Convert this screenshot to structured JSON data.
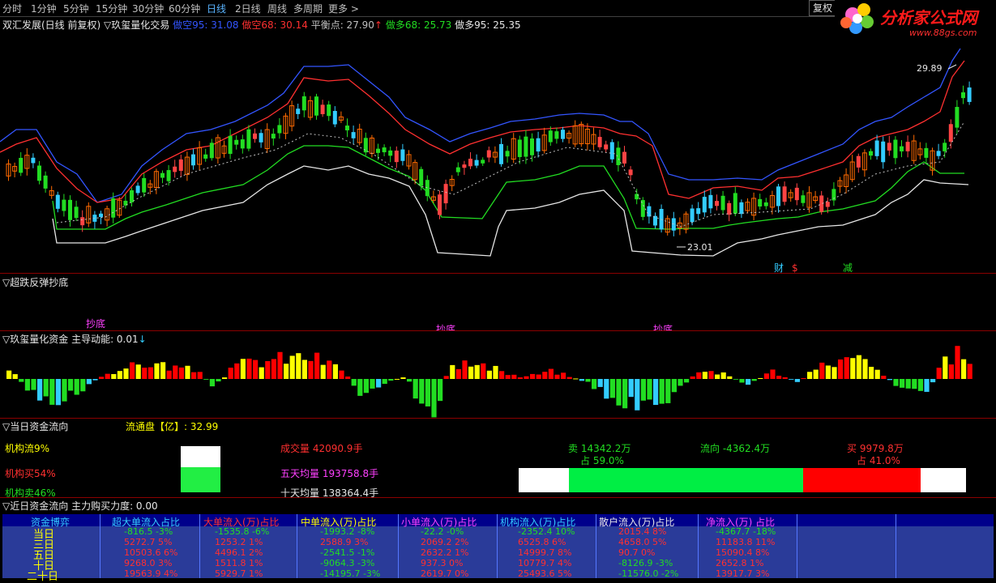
{
  "toolbar": {
    "periods": [
      "分时",
      "1分钟",
      "5分钟",
      "15分钟",
      "30分钟",
      "60分钟",
      "日线",
      "2日线",
      "周线",
      "多周期",
      "更多 >"
    ],
    "active": "日线",
    "restore_btn": "复权"
  },
  "logo": {
    "text": "分析家公式网",
    "url": "www.88gs.com"
  },
  "main_chart": {
    "stock_title": "双汇发展(日线 前复权)",
    "indicator": "▽玖玺量化交易",
    "legends": [
      {
        "label": "做空95: 31.08",
        "color": "#3355ff"
      },
      {
        "label": "做空68: 30.14",
        "color": "#ff3030"
      },
      {
        "label": "平衡点: 27.90",
        "color": "#c0c0c0"
      },
      {
        "label": "做多68: 25.73",
        "color": "#22dd22"
      },
      {
        "label": "做多95: 25.35",
        "color": "#e6e6e6"
      }
    ],
    "balance_arrow": "↑",
    "high_label": "29.89",
    "low_label": "23.01",
    "markers": [
      {
        "text": "财",
        "color": "#33ccff"
      },
      {
        "text": "$",
        "color": "#ff3030"
      },
      {
        "text": "减",
        "color": "#22dd22"
      }
    ]
  },
  "panel2": {
    "title": "▽超跌反弹抄底",
    "signal": "抄底",
    "color": "#ff40ff"
  },
  "panel3": {
    "title": "▽玖玺量化资金",
    "lead_label": "主导动能: 0.01",
    "arrow": "↓"
  },
  "panel4": {
    "title": "▽当日资金流向",
    "float_label": "流通盘【亿】: 32.99",
    "inst_flow": "机构流9%",
    "inst_buy": "机构买54%",
    "inst_sell": "机构卖46%",
    "volume": "成交量 42090.9手",
    "avg5": "五天均量 193758.8手",
    "avg10": "十天均量 138364.4手",
    "sell_amt": "卖 14342.2万",
    "sell_pct": "占 59.0%",
    "flow_dir": "流向 -4362.4万",
    "buy_amt": "买 9979.8万",
    "buy_pct": "占 41.0%",
    "sell_ratio": 0.59,
    "buy_ratio": 0.41,
    "inst_buy_ratio": 0.54
  },
  "panel5": {
    "title": "▽近日资金流向",
    "power_label": "主力购买力度: 0.00",
    "headers": [
      "资金博弈",
      "超大单流入占比",
      "大单流入(万)占比",
      "中单流入(万)占比",
      "小单流入(万)占比",
      "机构流入(万)占比",
      "散户流入(万)占比",
      "净流入(万) 占比"
    ],
    "header_colors": [
      "#33ccff",
      "#33ccff",
      "#ff3030",
      "#ffff00",
      "#ff40ff",
      "#33ccff",
      "#e6e6e6",
      "#ff40ff"
    ],
    "rows": [
      {
        "label": "当日",
        "cells": [
          "-816.5 -3%",
          "-1535.8 -6%",
          "-1993.2 -8%",
          "-22.2 -0%",
          "-2352.4 10%",
          "2015.4 8%",
          "-4367.7 -18%"
        ]
      },
      {
        "label": "三日",
        "cells": [
          "5272.7 5%",
          "1253.2 1%",
          "2588.9 3%",
          "2069.2 2%",
          "6525.8 6%",
          "4658.0 5%",
          "11183.8 11%"
        ]
      },
      {
        "label": "五日",
        "cells": [
          "10503.6 6%",
          "4496.1 2%",
          "-2541.5 -1%",
          "2632.2 1%",
          "14999.7 8%",
          "90.7 0%",
          "15090.4 8%"
        ]
      },
      {
        "label": "十日",
        "cells": [
          "9268.0 3%",
          "1511.8 1%",
          "-9064.3 -3%",
          "937.3 0%",
          "10779.7 4%",
          "-8126.9 -3%",
          "2652.8 1%"
        ]
      },
      {
        "label": "二十日",
        "cells": [
          "19563.9 4%",
          "5929.7 1%",
          "-14195.7 -3%",
          "2619.7 0%",
          "25493.6 5%",
          "-11576.0 -2%",
          "13917.7 3%"
        ]
      }
    ]
  },
  "colors": {
    "up": "#ff4444",
    "down": "#33ccff",
    "green": "#22dd22",
    "yellow": "#ffff00",
    "panel_border": "#8b0000"
  }
}
